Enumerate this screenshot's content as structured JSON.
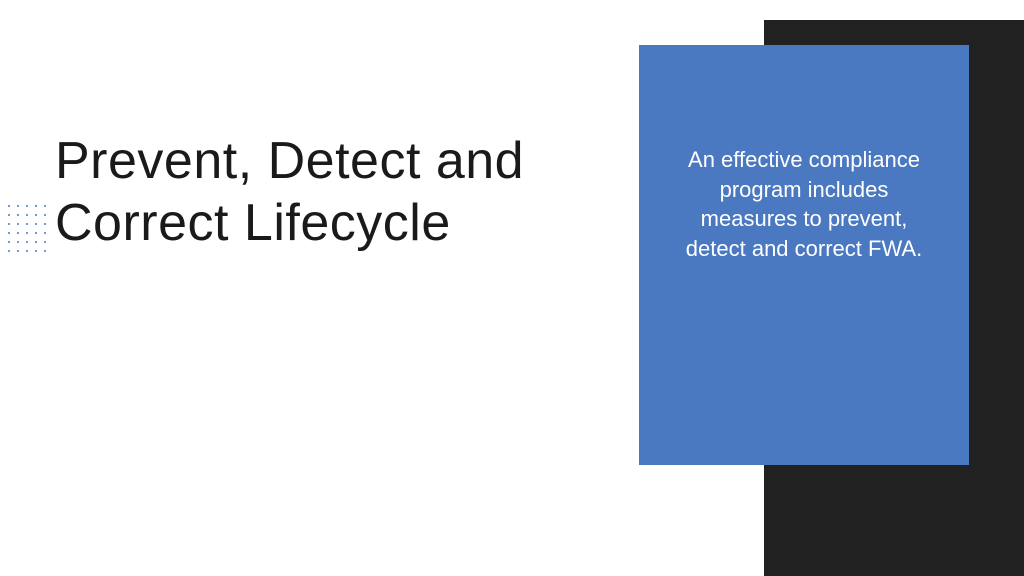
{
  "title": "Prevent, Detect and Correct Lifecycle",
  "panel": {
    "text": "An effective compliance program includes measures to prevent, detect and correct FWA."
  },
  "colors": {
    "blue": "#4a78c1",
    "dark": "#212121"
  }
}
